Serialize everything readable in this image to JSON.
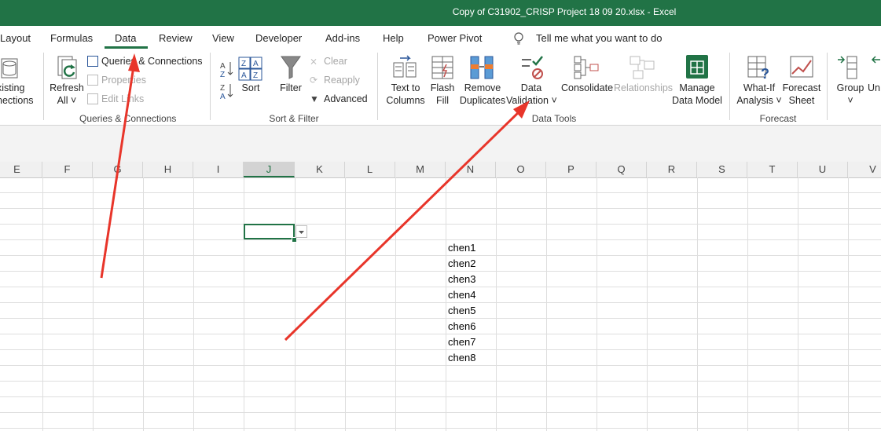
{
  "window": {
    "title": "Copy of C31902_CRISP Project 18 09 20.xlsx  -  Excel"
  },
  "tabs": [
    {
      "label": "Layout"
    },
    {
      "label": "Formulas"
    },
    {
      "label": "Data"
    },
    {
      "label": "Review"
    },
    {
      "label": "View"
    },
    {
      "label": "Developer"
    },
    {
      "label": "Add-ins"
    },
    {
      "label": "Help"
    },
    {
      "label": "Power Pivot"
    }
  ],
  "tell_me": "Tell me what you want to do",
  "ribbon": {
    "existing_connections": [
      "xisting",
      "nections"
    ],
    "refresh_all": [
      "Refresh",
      "All"
    ],
    "queries_connections": "Queries & Connections",
    "properties": "Properties",
    "edit_links": "Edit Links",
    "group_queries": "Queries & Connections",
    "sort_az": "Sort",
    "filter": "Filter",
    "clear": "Clear",
    "reapply": "Reapply",
    "advanced": "Advanced",
    "group_sort_filter": "Sort & Filter",
    "text_to_columns": [
      "Text to",
      "Columns"
    ],
    "flash_fill": [
      "Flash",
      "Fill"
    ],
    "remove_duplicates": [
      "Remove",
      "Duplicates"
    ],
    "data_validation": [
      "Data",
      "Validation"
    ],
    "consolidate": "Consolidate",
    "relationships": "Relationships",
    "manage_data_model": [
      "Manage",
      "Data Model"
    ],
    "group_data_tools": "Data Tools",
    "what_if": [
      "What-If",
      "Analysis"
    ],
    "forecast_sheet": [
      "Forecast",
      "Sheet"
    ],
    "group_forecast": "Forecast",
    "group": "Group",
    "ungroup": "Un"
  },
  "columns": [
    "E",
    "F",
    "G",
    "H",
    "I",
    "J",
    "K",
    "L",
    "M",
    "N",
    "O",
    "P",
    "Q",
    "R",
    "S",
    "T",
    "U",
    "V"
  ],
  "selected_column": "J",
  "cells_n": [
    "chen1",
    "chen2",
    "chen3",
    "chen4",
    "chen5",
    "chen6",
    "chen7",
    "chen8"
  ],
  "colors": {
    "excel_green": "#217346",
    "annotation_red": "#e8352a"
  }
}
